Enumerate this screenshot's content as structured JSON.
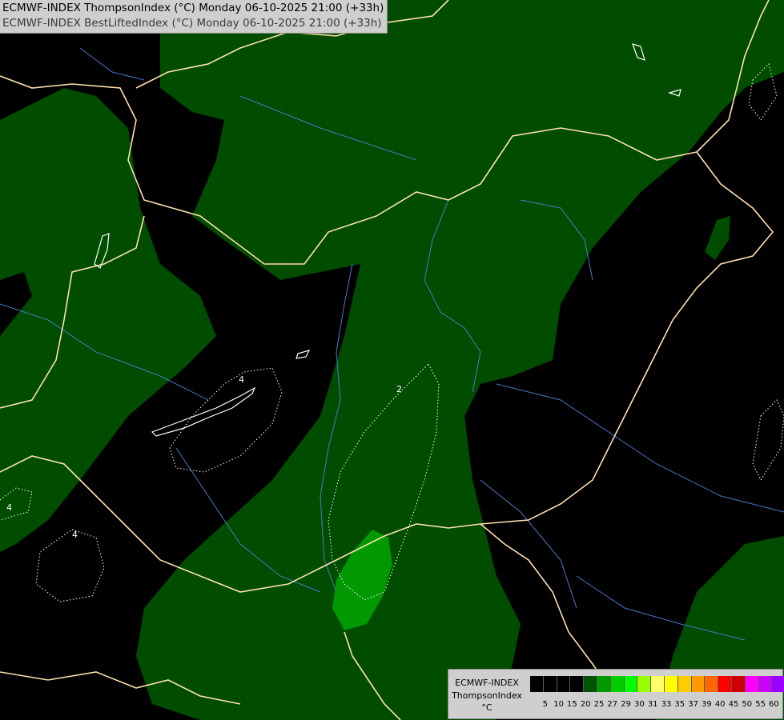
{
  "header": {
    "line1": "ECMWF-INDEX ThompsonIndex (°C) Monday 06-10-2025 21:00 (+33h)",
    "line2": "ECMWF-INDEX BestLiftedIndex (°C) Monday 06-10-2025 21:00 (+33h)"
  },
  "legend": {
    "title": "ECMWF-INDEX",
    "parameter": "ThompsonIndex",
    "unit": "°C",
    "ticks": [
      "5",
      "10",
      "15",
      "20",
      "25",
      "27",
      "29",
      "30",
      "31",
      "33",
      "35",
      "37",
      "39",
      "40",
      "45",
      "50",
      "55",
      "60"
    ],
    "colors": [
      "#000000",
      "#000000",
      "#000000",
      "#000000",
      "#005500",
      "#009900",
      "#00cc00",
      "#00ff00",
      "#99ff00",
      "#ffff66",
      "#ffff00",
      "#ffcc00",
      "#ff9900",
      "#ff6600",
      "#ff0000",
      "#cc0000",
      "#ff00ff",
      "#cc00ff",
      "#9900ff",
      "#6600ff",
      "#0000ff"
    ]
  },
  "contour_labels": {
    "lifted_2": "2",
    "lifted_4a": "4",
    "lifted_4b": "4",
    "lifted_4c": "4"
  },
  "colors": {
    "background": "#000000",
    "green_dark": "#004d00",
    "green_mid": "#009900",
    "borders": "#ffe0b0",
    "rivers": "#4a78c8",
    "contours": "#ffffff"
  }
}
